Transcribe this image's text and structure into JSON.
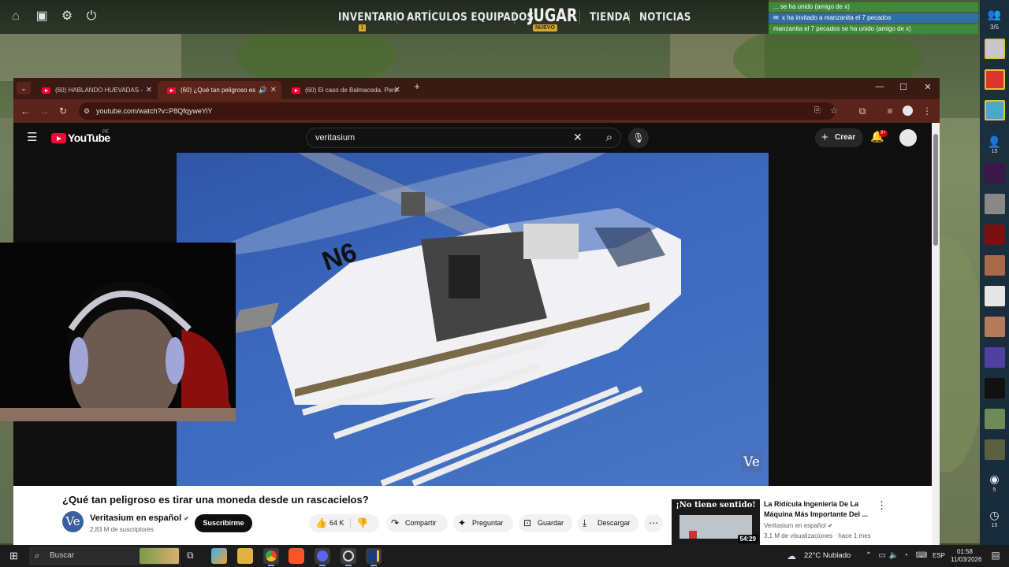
{
  "game": {
    "nav": {
      "inventario": "INVENTARIO",
      "inventario_badge": "1",
      "articulos": "ARTÍCULOS EQUIPADOS",
      "jugar": "JUGAR",
      "jugar_badge": "NUEVO",
      "tienda": "TIENDA",
      "noticias": "NOTICIAS"
    },
    "notifications": [
      "... se ha unido (amigo de x)",
      "x ha invitado a manzanita  el 7 pecados",
      "manzanita  el 7 pecados se ha unido (amigo de x)"
    ],
    "friends": {
      "party_count": "3/5",
      "friends_online": "15",
      "broadcast_count": "5",
      "recent_count": "15"
    }
  },
  "browser": {
    "tabs": [
      {
        "label": "(60) HABLANDO HUEVADAS - "
      },
      {
        "label": "(60) ¿Qué tan peligroso es "
      },
      {
        "label": "(60) El caso de Balmaceda. Pers"
      }
    ],
    "url": "youtube.com/watch?v=P8QfqyweYiY"
  },
  "youtube": {
    "logo": "YouTube",
    "region": "PE",
    "search_value": "veritasium",
    "create_label": "Crear",
    "notif_badge": "9+",
    "video": {
      "watermark": "Ve",
      "title": "¿Qué tan peligroso es tirar una moneda desde un rascacielos?",
      "channel": "Veritasium en español",
      "channel_avatar": "Ve",
      "subscribers": "2,83 M de suscriptores",
      "subscribe_label": "Suscribirme",
      "likes": "64 K",
      "share_label": "Compartir",
      "ask_label": "Preguntar",
      "save_label": "Guardar",
      "download_label": "Descargar"
    },
    "recommended": {
      "thumb_text": "¡No tiene sentido!",
      "duration": "54:29",
      "title": "La Ridícula Ingeniería De La Máquina Más Importante Del ...",
      "channel": "Veritasium en español",
      "views": "3,1 M de visualizaciones",
      "age": "hace 1 mes"
    }
  },
  "taskbar": {
    "search_placeholder": "Buscar",
    "weather": "22°C  Nublado",
    "language": "ESP",
    "time": "01:58",
    "date": "11/03/2026"
  }
}
